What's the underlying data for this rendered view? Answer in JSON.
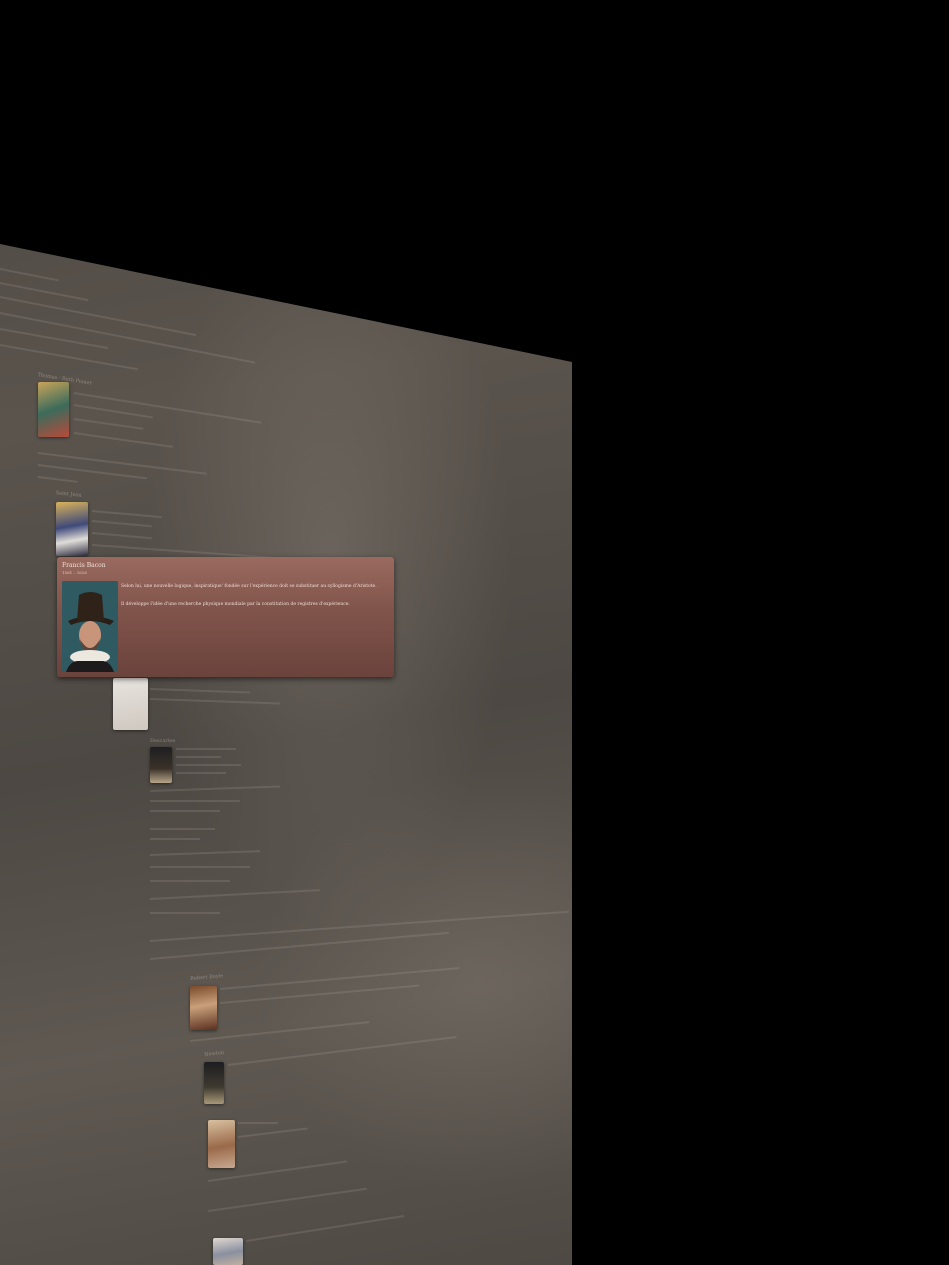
{
  "timeline": {
    "featured": {
      "name": "Francis Bacon",
      "dates": "1561 – 1626",
      "paragraph1": "Selon lui, une nouvelle logique, inspiratique' fondée sur l'expérience doit se substituer au syllogisme d'Aristote.",
      "paragraph2": "Il développe l'idée d'une recherche physique mondiale par la constitution de registres d'expérience."
    },
    "thumb_labels": {
      "l1": "Thomas · Ruth Pianer",
      "l2": "Saint Jean",
      "l3": "Descartes",
      "l4": "Robert Boyle",
      "l5": "Newton"
    }
  }
}
